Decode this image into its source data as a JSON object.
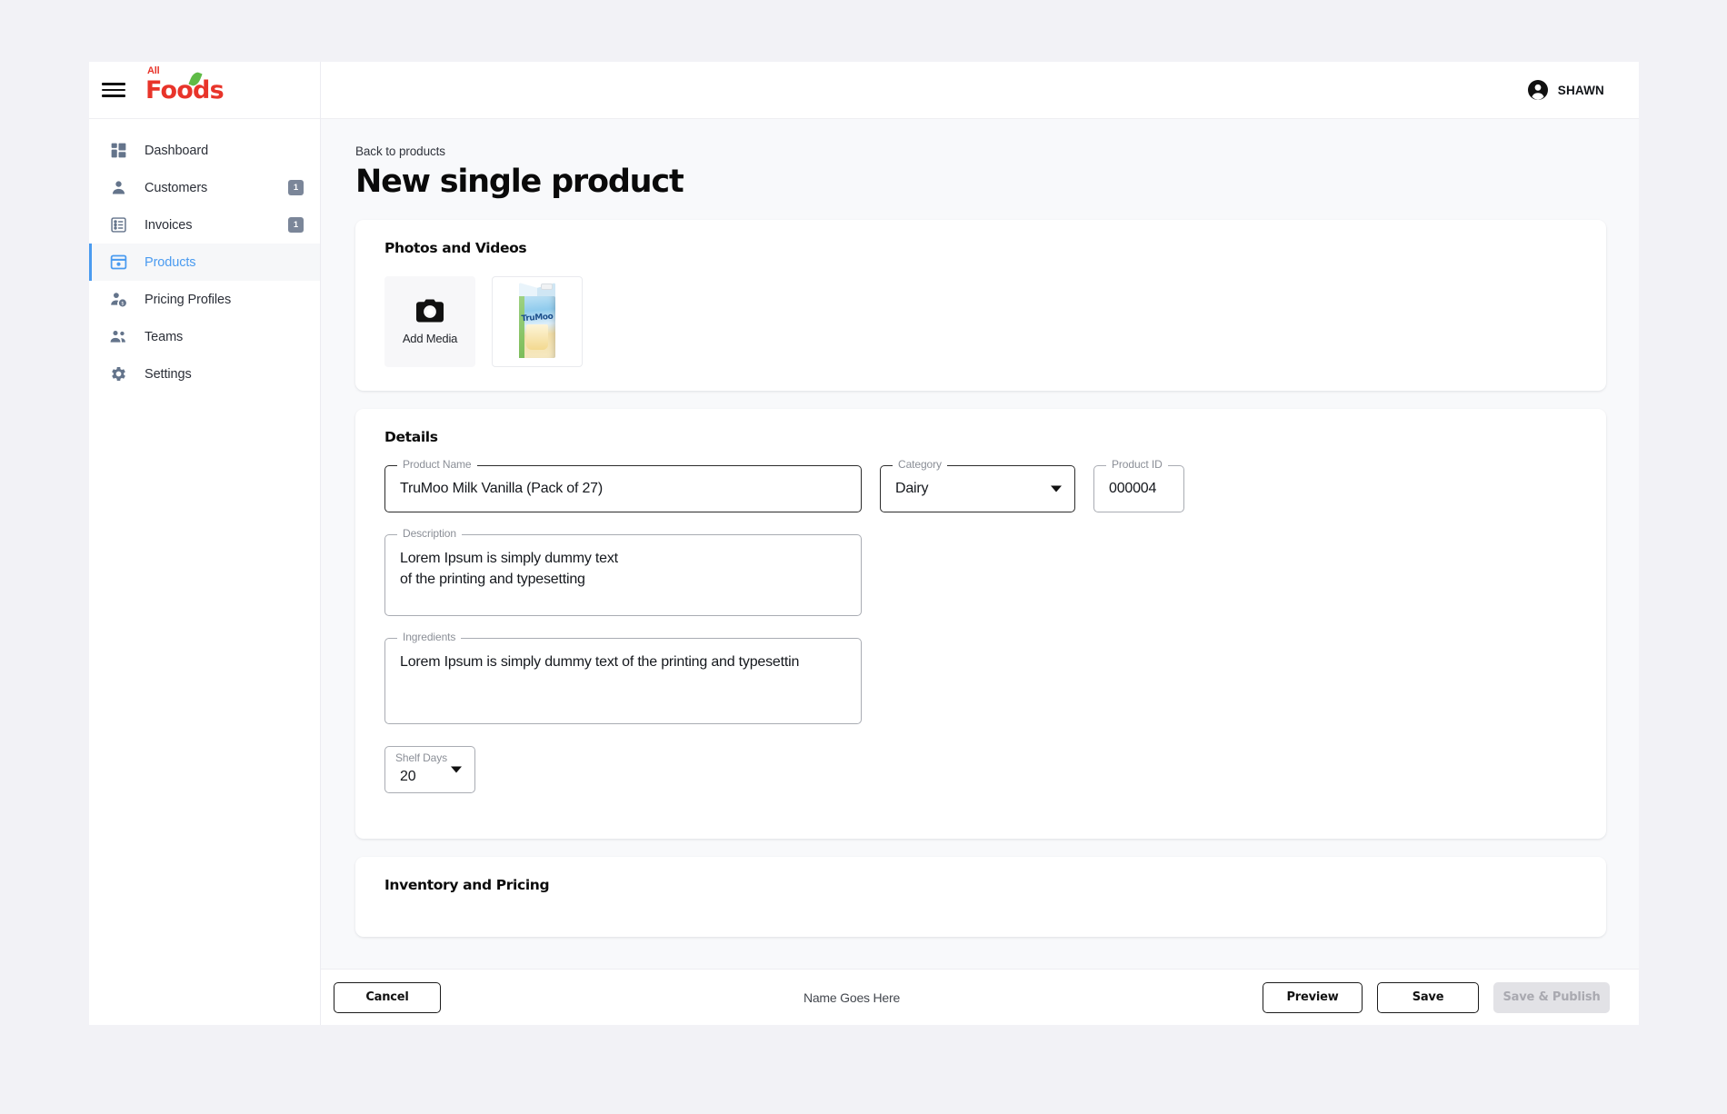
{
  "brand": {
    "logo_small": "All",
    "logo_main": "Foods",
    "logo_color": "#e8342a",
    "leaf_color": "#5fbb46"
  },
  "accent_color": "#4a9bf0",
  "sidebar": {
    "items": [
      {
        "label": "Dashboard",
        "icon": "dashboard-icon",
        "badge": null,
        "active": false
      },
      {
        "label": "Customers",
        "icon": "person-icon",
        "badge": "1",
        "active": false
      },
      {
        "label": "Invoices",
        "icon": "list-icon",
        "badge": "1",
        "active": false
      },
      {
        "label": "Products",
        "icon": "product-box-icon",
        "badge": null,
        "active": true
      },
      {
        "label": "Pricing Profiles",
        "icon": "person-dollar-icon",
        "badge": null,
        "active": false
      },
      {
        "label": "Teams",
        "icon": "people-icon",
        "badge": null,
        "active": false
      },
      {
        "label": "Settings",
        "icon": "gear-icon",
        "badge": null,
        "active": false
      }
    ]
  },
  "topbar": {
    "user_name": "SHAWN",
    "avatar_icon": "account-circle-icon"
  },
  "page": {
    "back_link": "Back to products",
    "title": "New single product"
  },
  "media": {
    "card_title": "Photos and Videos",
    "add_media_label": "Add Media",
    "add_media_icon": "camera-icon",
    "thumbnails": [
      {
        "alt": "TruMoo Milk Vanilla carton",
        "brand_text": "TruMoo"
      }
    ]
  },
  "details": {
    "card_title": "Details",
    "fields": {
      "product_name": {
        "label": "Product Name",
        "value": "TruMoo Milk Vanilla (Pack of 27)"
      },
      "category": {
        "label": "Category",
        "value": "Dairy"
      },
      "product_id": {
        "label": "Product ID",
        "value": "000004"
      },
      "description": {
        "label": "Description",
        "line1": "Lorem Ipsum is simply dummy text",
        "line2": "of the printing and typesetting"
      },
      "ingredients": {
        "label": "Ingredients",
        "value": "Lorem Ipsum is simply dummy text of the printing and typesettin"
      },
      "shelf_days": {
        "label": "Shelf Days",
        "value": "20"
      }
    }
  },
  "inventory": {
    "card_title": "Inventory and Pricing"
  },
  "actionbar": {
    "cancel_label": "Cancel",
    "name_text": "Name Goes Here",
    "preview_label": "Preview",
    "save_label": "Save",
    "publish_label": "Save & Publish"
  }
}
